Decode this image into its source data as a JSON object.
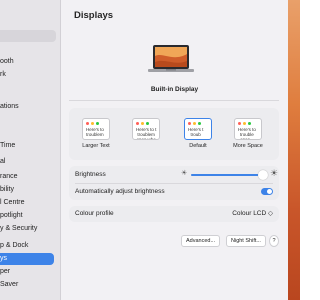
{
  "window": {
    "title": "Displays"
  },
  "sidebar": {
    "items": [
      {
        "label": "ooth"
      },
      {
        "label": "rk"
      },
      {
        "label": "ations"
      },
      {
        "label": "Time"
      },
      {
        "label": "al"
      },
      {
        "label": "rance"
      },
      {
        "label": "bility"
      },
      {
        "label": "l Centre"
      },
      {
        "label": "potlight"
      },
      {
        "label": "y & Security"
      },
      {
        "label": "p & Dock"
      },
      {
        "label": "ys"
      },
      {
        "label": "per"
      },
      {
        "label": "Saver"
      }
    ],
    "selected_index": 11
  },
  "display": {
    "name": "Built-in Display",
    "icon": "laptop-icon"
  },
  "resolution_options": [
    {
      "label": "Larger Text",
      "preview": "Here's to\ntroublem"
    },
    {
      "label": "",
      "preview": "Here's to t\ntroublem\nones who"
    },
    {
      "label": "Default",
      "preview": "Here's t\ntroub"
    },
    {
      "label": "More Space",
      "preview": "Here's to\ntrouble\nones..."
    }
  ],
  "selected_resolution": 2,
  "brightness": {
    "label": "Brightness",
    "value": 0.95
  },
  "auto_brightness": {
    "label": "Automatically adjust brightness",
    "enabled": true
  },
  "colour_profile": {
    "label": "Colour profile",
    "value": "Colour LCD ◇"
  },
  "buttons": {
    "advanced": "Advanced...",
    "night_shift": "Night Shift...",
    "help": "?"
  },
  "colors": {
    "accent": "#3d83e8",
    "wallpaper": "#df7d3e"
  }
}
